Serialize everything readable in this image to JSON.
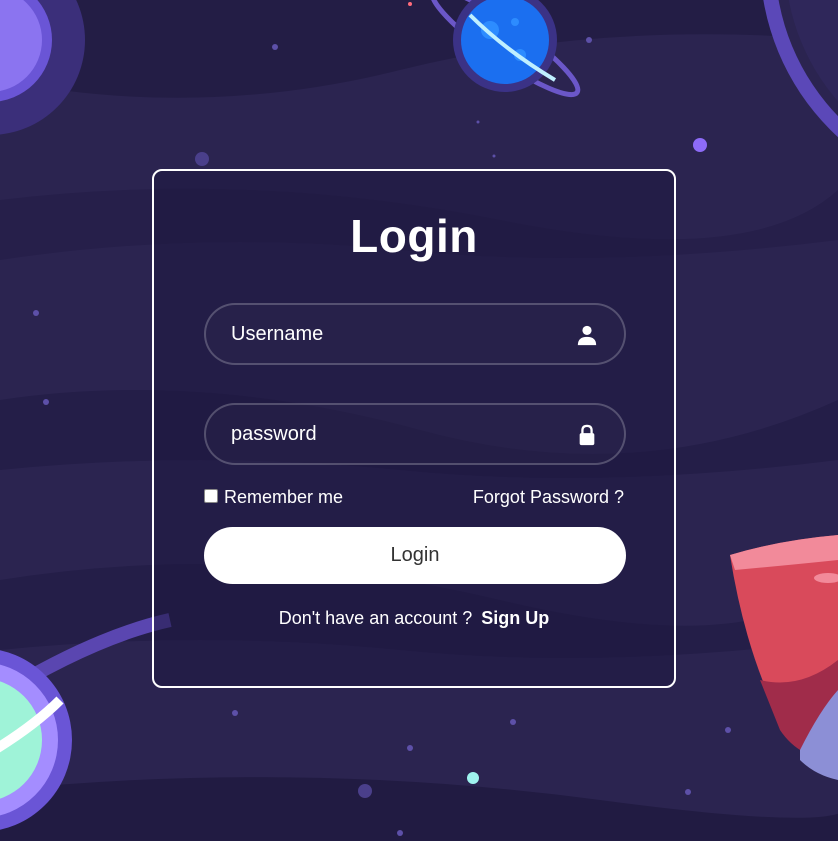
{
  "colors": {
    "background": "#2b2450",
    "card_border": "#ffffff",
    "button_bg": "#ffffff",
    "button_text": "#333333"
  },
  "login": {
    "title": "Login",
    "username_placeholder": "Username",
    "username_icon": "user-icon",
    "password_placeholder": "password",
    "password_icon": "lock-icon",
    "remember_label": "Remember me",
    "remember_checked": false,
    "forgot_label": "Forgot Password ?",
    "submit_label": "Login",
    "signup_prompt": "Don't have an account ?",
    "signup_link": "Sign Up"
  }
}
